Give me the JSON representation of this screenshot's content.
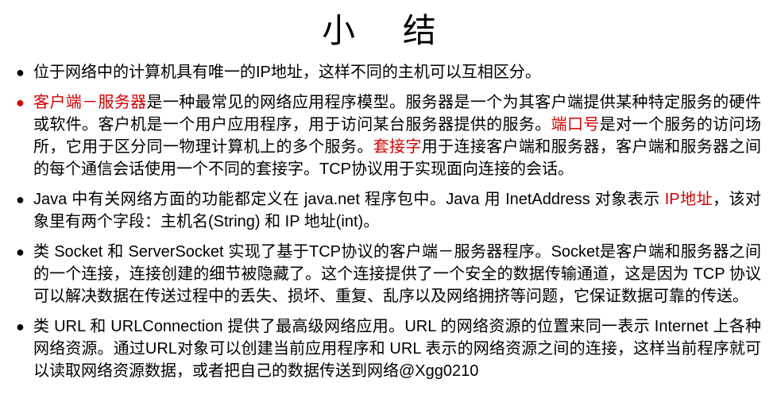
{
  "title": "小 结",
  "items": [
    {
      "segments": [
        {
          "text": "位于网络中的计算机具有唯一的IP地址，这样不同的主机可以互相区分。"
        }
      ]
    },
    {
      "redBullet": true,
      "segments": [
        {
          "text": "客户端－服务器",
          "red": true
        },
        {
          "text": "是一种最常见的网络应用程序模型。服务器是一个为其客户端提供某种特定服务的硬件或软件。客户机是一个用户应用程序，用于访问某台服务器提供的服务。"
        },
        {
          "text": "端口号",
          "red": true
        },
        {
          "text": "是对一个服务的访问场所，它用于区分同一物理计算机上的多个服务。"
        },
        {
          "text": "套接字",
          "red": true
        },
        {
          "text": "用于连接客户端和服务器，客户端和服务器之间的每个通信会话使用一个不同的套接字。TCP协议用于实现面向连接的会话。"
        }
      ]
    },
    {
      "segments": [
        {
          "text": "Java 中有关网络方面的功能都定义在 java.net 程序包中。Java 用 InetAddress 对象表示 "
        },
        {
          "text": "IP地址",
          "red": true
        },
        {
          "text": "，该对象里有两个字段：主机名(String) 和 IP 地址(int)。"
        }
      ]
    },
    {
      "segments": [
        {
          "text": "类 Socket 和 ServerSocket 实现了基于TCP协议的客户端－服务器程序。Socket是客户端和服务器之间的一个连接，连接创建的细节被隐藏了。这个连接提供了一个安全的数据传输通道，这是因为 TCP 协议可以解决数据在传送过程中的丢失、损坏、重复、乱序以及网络拥挤等问题，它保证数据可靠的传送。"
        }
      ]
    },
    {
      "segments": [
        {
          "text": "类 URL 和 URLConnection 提供了最高级网络应用。URL 的网络资源的位置来同一表示 Internet 上各种网络资源。通过URL对象可以创建当前应用程序和 URL 表示的网络资源之间的连接，这样当前程序就可以读取网络资源数据，或者把自己的数据传送到网络@Xgg0210"
        }
      ]
    }
  ]
}
